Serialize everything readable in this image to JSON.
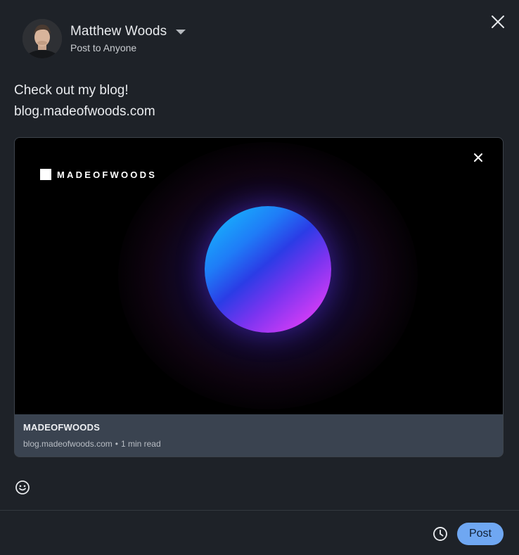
{
  "composer": {
    "author_name": "Matthew Woods",
    "audience_label": "Post to Anyone",
    "post_lines": [
      "Check out my blog!",
      "blog.madeofwoods.com"
    ]
  },
  "link_preview": {
    "brand_logo_text": "MADEOFWOODS",
    "title": "MADEOFWOODS",
    "domain": "blog.madeofwoods.com",
    "separator": "•",
    "read_time": "1 min read"
  },
  "footer": {
    "post_label": "Post"
  },
  "icons": {
    "close": "close-icon",
    "dropdown": "chevron-down-icon",
    "remove_preview": "close-icon",
    "emoji": "emoji-icon",
    "schedule": "clock-icon"
  },
  "colors": {
    "background": "#1e2228",
    "card_footer": "#3a4350",
    "post_button": "#6fa7f2"
  }
}
